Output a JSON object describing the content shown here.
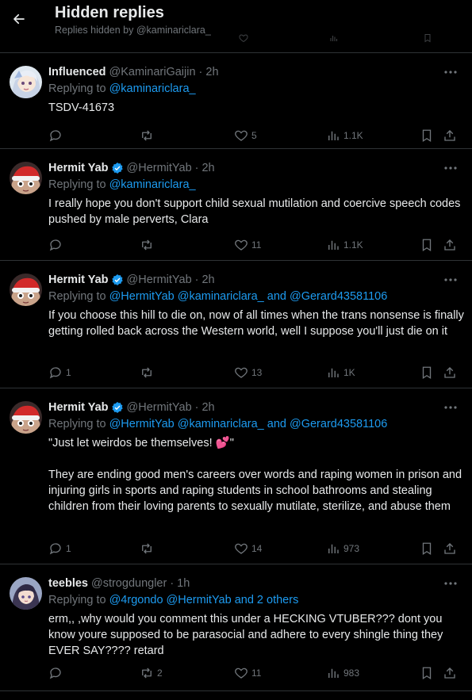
{
  "header": {
    "title": "Hidden replies",
    "subtitle": "Replies hidden by @kaminariclara_"
  },
  "colors": {
    "background": "#000000",
    "text": "#e7e9ea",
    "muted": "#71767b",
    "accent": "#1d9bf0",
    "divider": "#2f3336"
  },
  "tweets": [
    {
      "display_name": "Influenced",
      "handle": "@KaminariGaijin",
      "time": "2h",
      "verified": false,
      "replying_prefix": "Replying to",
      "replying_to": "@kaminariclara_",
      "replying_rest": "",
      "text": "TSDV-41673",
      "replies": "",
      "retweets": "",
      "likes": "5",
      "views": "1.1K",
      "avatar": "anime-character-avatar"
    },
    {
      "display_name": "Hermit Yab",
      "handle": "@HermitYab",
      "time": "2h",
      "verified": true,
      "replying_prefix": "Replying to",
      "replying_to": "@kaminariclara_",
      "replying_rest": "",
      "text": "I really hope you don't support child sexual mutilation and coercive speech codes pushed by male perverts, Clara",
      "replies": "",
      "retweets": "",
      "likes": "11",
      "views": "1.1K",
      "avatar": "santa-hat-avatar"
    },
    {
      "display_name": "Hermit Yab",
      "handle": "@HermitYab",
      "time": "2h",
      "verified": true,
      "replying_prefix": "Replying to",
      "replying_to": "@HermitYab @kaminariclara_ and @Gerard43581106",
      "replying_rest": "",
      "text": "If you choose this hill to die on, now of all times when the trans nonsense is finally getting rolled back across the Western world, well I suppose you'll just die on it",
      "replies": "1",
      "retweets": "",
      "likes": "13",
      "views": "1K",
      "avatar": "santa-hat-avatar"
    },
    {
      "display_name": "Hermit Yab",
      "handle": "@HermitYab",
      "time": "2h",
      "verified": true,
      "replying_prefix": "Replying to",
      "replying_to": "@HermitYab @kaminariclara_ and @Gerard43581106",
      "replying_rest": "",
      "text": "\"Just let weirdos be themselves! 💕\"\n\nThey are ending good men's careers over words and raping women in prison and injuring girls in sports and raping students in school bathrooms and stealing children from their loving parents to sexually mutilate, sterilize, and abuse them",
      "replies": "1",
      "retweets": "",
      "likes": "14",
      "views": "973",
      "avatar": "santa-hat-avatar"
    },
    {
      "display_name": "teebles",
      "handle": "@strogdungler",
      "time": "1h",
      "verified": false,
      "replying_prefix": "Replying to",
      "replying_to": "@4rgondo @HermitYab and 2 others",
      "replying_rest": "",
      "text": "erm,, ,why would you comment this under a HECKING VTUBER??? dont you know youre supposed to be parasocial and adhere to every shingle thing they EVER SAY???? retard",
      "replies": "",
      "retweets": "2",
      "likes": "11",
      "views": "983",
      "avatar": "anime-character-avatar-dark"
    }
  ]
}
